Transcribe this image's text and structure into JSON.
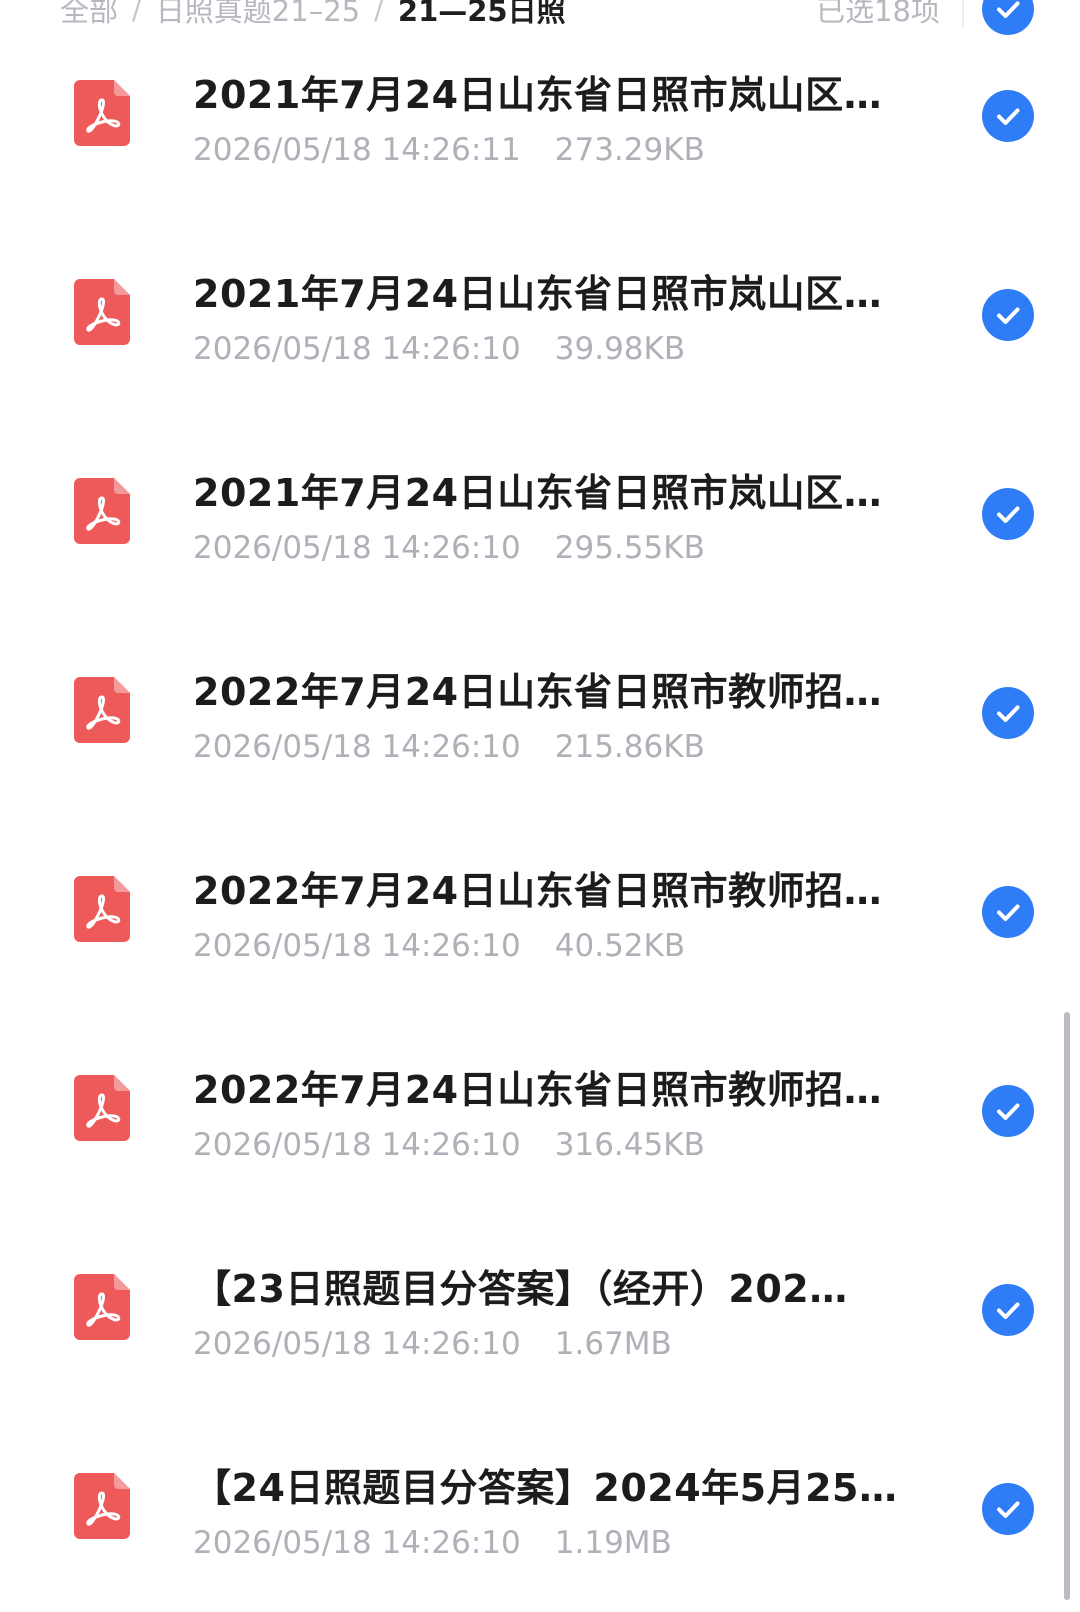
{
  "breadcrumb": {
    "items": [
      "全部",
      "日照真题21–25",
      "21—25日照"
    ],
    "separator": "/"
  },
  "selection": {
    "count_label": "已选18项"
  },
  "files": [
    {
      "title": "2021年7月24日山东省日照市岚山区…",
      "date": "2026/05/18 14:26:11",
      "size": "273.29KB",
      "type_icon": "pdf-icon",
      "selected": true
    },
    {
      "title": "2021年7月24日山东省日照市岚山区…",
      "date": "2026/05/18 14:26:10",
      "size": "39.98KB",
      "type_icon": "pdf-icon",
      "selected": true
    },
    {
      "title": "2021年7月24日山东省日照市岚山区…",
      "date": "2026/05/18 14:26:10",
      "size": "295.55KB",
      "type_icon": "pdf-icon",
      "selected": true
    },
    {
      "title": "2022年7月24日山东省日照市教师招…",
      "date": "2026/05/18 14:26:10",
      "size": "215.86KB",
      "type_icon": "pdf-icon",
      "selected": true
    },
    {
      "title": "2022年7月24日山东省日照市教师招…",
      "date": "2026/05/18 14:26:10",
      "size": "40.52KB",
      "type_icon": "pdf-icon",
      "selected": true
    },
    {
      "title": "2022年7月24日山东省日照市教师招…",
      "date": "2026/05/18 14:26:10",
      "size": "316.45KB",
      "type_icon": "pdf-icon",
      "selected": true
    },
    {
      "title": "【23日照题目分答案】（经开）202…",
      "date": "2026/05/18 14:26:10",
      "size": "1.67MB",
      "type_icon": "pdf-icon",
      "selected": true
    },
    {
      "title": "【24日照题目分答案】2024年5月25…",
      "date": "2026/05/18 14:26:10",
      "size": "1.19MB",
      "type_icon": "pdf-icon",
      "selected": true
    }
  ],
  "colors": {
    "accent": "#2f7df6",
    "pdf_red": "#ee5a5a",
    "secondary_text": "#aeb1b7"
  }
}
